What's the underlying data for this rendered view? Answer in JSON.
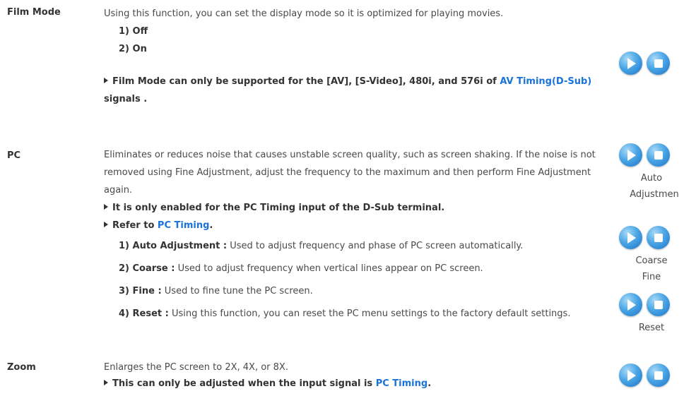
{
  "film_mode": {
    "term": "Film Mode",
    "description": "Using this function, you can set the display mode so it is optimized for playing movies.",
    "options": [
      "1) Off",
      "2) On"
    ],
    "note_pre": "Film Mode can only be supported for the [AV], [S-Video], 480i, and 576i of ",
    "note_link": "AV Timing(D-Sub)",
    "note_post": " signals ."
  },
  "pc": {
    "term": "PC",
    "description": "Eliminates or reduces noise that causes unstable screen quality, such as screen shaking. If the noise is not removed using Fine Adjustment, adjust the frequency to the maximum and then perform Fine Adjustment again.",
    "note1": "It is only enabled for the PC Timing input of the D-Sub terminal.",
    "note2_pre": "Refer to ",
    "note2_link": "PC Timing",
    "note2_post": ".",
    "items": [
      {
        "label": "1) Auto Adjustment :",
        "text": " Used to adjust frequency and phase of PC screen automatically."
      },
      {
        "label": "2) Coarse :",
        "text": " Used to adjust frequency when vertical lines appear on PC screen."
      },
      {
        "label": "3) Fine :",
        "text": " Used to fine tune the PC screen."
      },
      {
        "label": "4) Reset :",
        "text": " Using this function, you can reset the PC menu settings to the factory default settings."
      }
    ]
  },
  "zoom": {
    "term": "Zoom",
    "description": "Enlarges the PC screen to 2X, 4X, or 8X.",
    "note_pre": "This can only be adjusted when the input signal is ",
    "note_link": "PC Timing",
    "note_post": "."
  },
  "side_labels": {
    "auto_line1": "Auto",
    "auto_line2": "Adjustmen",
    "coarse": "Coarse",
    "fine": "Fine",
    "reset": "Reset"
  },
  "icons": {
    "play": "play-icon",
    "stop": "stop-icon"
  },
  "colors": {
    "link": "#1a73d9",
    "button": "#4aa6e6"
  }
}
